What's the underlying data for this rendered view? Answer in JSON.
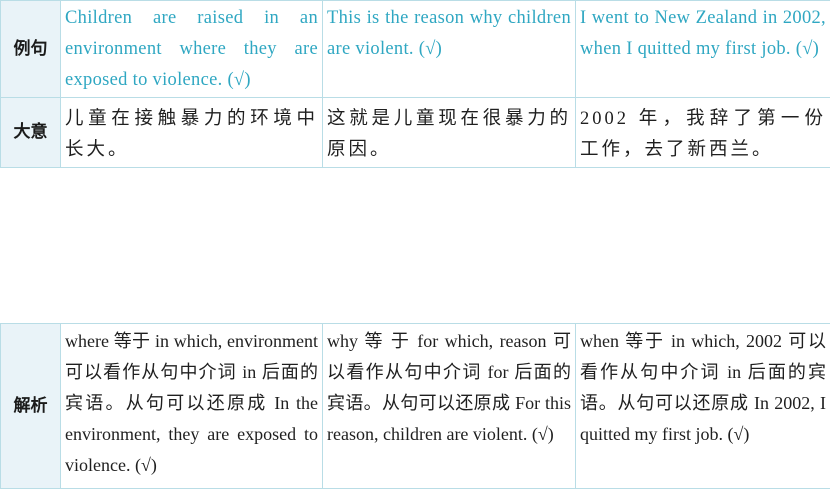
{
  "labels": {
    "example": "例句",
    "meaning": "大意",
    "analysis": "解析"
  },
  "examples": [
    "Children are raised in an environment where they are exposed to violence. (√)",
    "This is the reason why children are violent. (√)",
    "I went to New Zealand in 2002, when I quitted my first job. (√)"
  ],
  "meanings": [
    "儿童在接触暴力的环境中长大。",
    "这就是儿童现在很暴力的原因。",
    "2002 年，我辞了第一份工作，去了新西兰。"
  ],
  "analyses": [
    "where 等于 in which, environment 可以看作从句中介词 in 后面的宾语。从句可以还原成 In the environment, they are exposed to violence. (√)",
    "why 等 于 for which, reason 可以看作从句中介词 for 后面的宾语。从句可以还原成 For this reason, children are violent. (√)",
    "when 等于 in which, 2002 可以看作从句中介词 in 后面的宾语。从句可以还原成 In 2002, I quitted my first job. (√)"
  ],
  "colors": {
    "border": "#b9dde6",
    "header_bg": "#e9f3f8",
    "example_text": "#2fa7c2",
    "body_text": "#1f1f1f"
  }
}
